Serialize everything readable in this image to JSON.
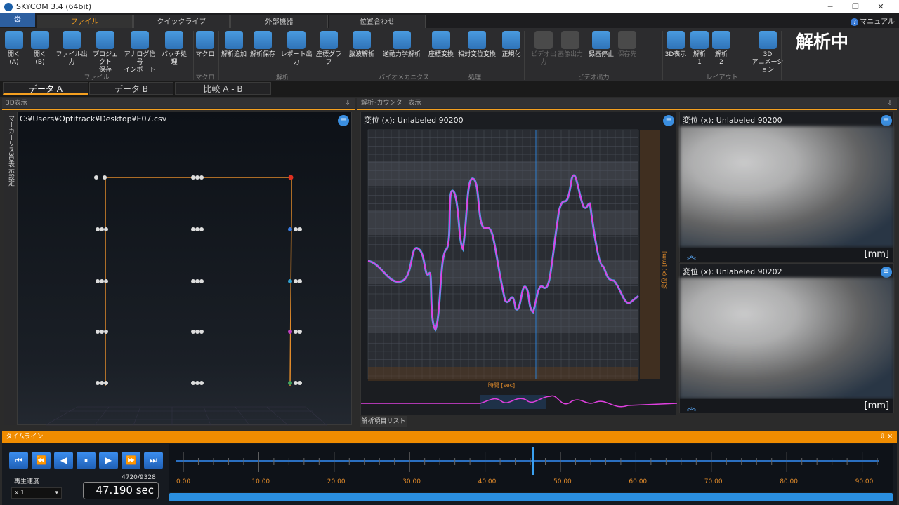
{
  "window": {
    "title": "SKYCOM 3.4 (64bit)",
    "min": "─",
    "max": "❐",
    "close": "✕"
  },
  "ribbon_tabs": [
    "ファイル",
    "クイックライブ",
    "外部機器",
    "位置合わせ"
  ],
  "manual": "マニュアル",
  "gear": "⚙",
  "ribbon": {
    "buttons": [
      {
        "label": "開く (A)",
        "icon": "folder-a-icon"
      },
      {
        "label": "開く (B)",
        "icon": "folder-b-icon"
      },
      {
        "label": "ファイル出力",
        "icon": "folder-export-icon"
      },
      {
        "label": "プロジェクト\n保存",
        "icon": "project-save-icon"
      },
      {
        "label": "アナログ信号\nインポート",
        "icon": "analog-import-icon"
      },
      {
        "label": "バッチ処理",
        "icon": "batch-icon"
      },
      {
        "label": "マクロ",
        "icon": "macro-icon"
      },
      {
        "label": "解析追加",
        "icon": "analysis-add-icon"
      },
      {
        "label": "解析保存",
        "icon": "analysis-save-icon"
      },
      {
        "label": "レポート出力",
        "icon": "report-icon"
      },
      {
        "label": "座標グラフ",
        "icon": "xyz-graph-icon"
      },
      {
        "label": "脳波解析",
        "icon": "brain-icon"
      },
      {
        "label": "逆動力学解析",
        "icon": "walker-icon"
      },
      {
        "label": "座標変換",
        "icon": "coord-transform-icon"
      },
      {
        "label": "相対変位変換",
        "icon": "relative-disp-icon"
      },
      {
        "label": "正規化",
        "icon": "normalize-icon"
      },
      {
        "label": "ビデオ出力",
        "icon": "video-out-icon"
      },
      {
        "label": "画像出力",
        "icon": "image-out-icon"
      },
      {
        "label": "録画停止",
        "icon": "record-stop-icon"
      },
      {
        "label": "保存先",
        "icon": "save-dest-icon"
      },
      {
        "label": "3D表示",
        "icon": "3d-view-icon"
      },
      {
        "label": "解析\n1",
        "icon": "layout-1-icon"
      },
      {
        "label": "解析\n2",
        "icon": "layout-2-icon"
      },
      {
        "label": "3D\nアニメーション",
        "icon": "3d-animation-icon"
      }
    ],
    "groups": [
      "ファイル",
      "マクロ",
      "解析",
      "バイオメカニクス",
      "処理",
      "ビデオ出力",
      "レイアウト"
    ],
    "status": "解析中"
  },
  "data_tabs": [
    "データ A",
    "データ B",
    "比較 A - B"
  ],
  "panel_3d": {
    "header": "3D表示",
    "path": "C:¥Users¥Optitrack¥Desktop¥E07.csv",
    "side_tabs": [
      "マーカーリスト",
      "3D表示設定"
    ]
  },
  "panel_graph": {
    "header": "解析･カウンター表示",
    "title": "変位 (x):  Unlabeled 90200",
    "ylabel": "変位 (x) [mm]",
    "xlabel": "時間 [sec]"
  },
  "side_panels": [
    {
      "title": "変位 (x):  Unlabeled 90200",
      "unit": "[mm]",
      "chev": "︽"
    },
    {
      "title": "変位 (x):  Unlabeled 90202",
      "unit": "[mm]",
      "chev": "︽"
    }
  ],
  "analysis_list_tab": "解析項目リスト",
  "timeline": {
    "header": "タイムライン",
    "pin": "⇩  ✕",
    "speed_label": "再生速度",
    "speed_value": "x 1",
    "frame": "4720/9328",
    "time": "47.190 sec",
    "position_fraction": 0.506,
    "ticks": [
      "0.00",
      "10.00",
      "20.00",
      "30.00",
      "40.00",
      "50.00",
      "60.00",
      "70.00",
      "80.00",
      "90.00"
    ],
    "controls": [
      "⏮",
      "⏪",
      "◀",
      "⏸",
      "▶",
      "⏩",
      "⏭"
    ]
  },
  "accent_color": "#f5a020"
}
